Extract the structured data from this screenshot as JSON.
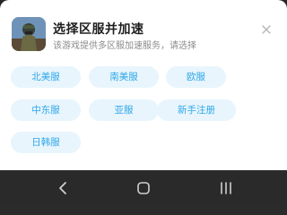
{
  "dialog": {
    "title": "选择区服并加速",
    "subtitle": "该游戏提供多区服加速服务，请选择",
    "close_icon": "close-icon",
    "app_icon": "game-app-icon"
  },
  "servers": [
    {
      "label": "北美服"
    },
    {
      "label": "南美服"
    },
    {
      "label": "欧服"
    },
    {
      "label": "中东服"
    },
    {
      "label": "亚服"
    },
    {
      "label": "新手注册"
    },
    {
      "label": "日韩服"
    }
  ],
  "colors": {
    "accent": "#2fa7e8",
    "chip_background": "#e8f5fd",
    "navbar_background": "#2a2a2a"
  },
  "navbar": {
    "back_icon": "back-icon",
    "home_icon": "home-icon",
    "recents_icon": "recents-icon"
  }
}
